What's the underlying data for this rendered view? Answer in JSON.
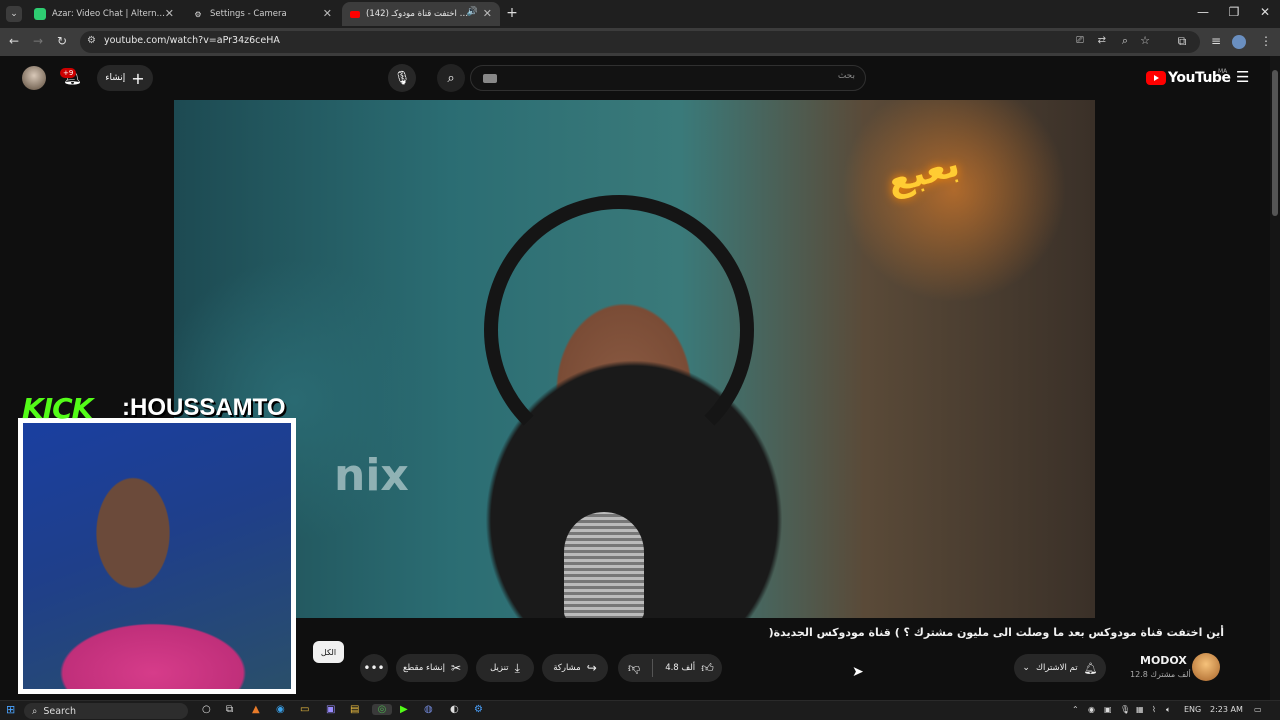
{
  "browser": {
    "tabs": [
      {
        "title": "Azar: Video Chat | Alternative to",
        "icon": "azar-icon",
        "color": "#2ecc71"
      },
      {
        "title": "Settings - Camera",
        "icon": "gear-icon",
        "color": "#9e9e9e"
      },
      {
        "title": "أين اختفت قناة مودوكـ (142)",
        "icon": "youtube-icon",
        "color": "#ff0000",
        "active": true
      }
    ],
    "new_tab_label": "+",
    "url": "youtube.com/watch?v=aPr34z6ceHA",
    "window_controls": [
      "—",
      "❐",
      "✕"
    ]
  },
  "youtube": {
    "logo_text": "YouTube",
    "region": "MA",
    "search_placeholder": "بحث",
    "create_label": "إنشاء",
    "notification_count": "+9"
  },
  "overlay": {
    "platform": "KICK",
    "username": ":HOUSSAMTO"
  },
  "video": {
    "title": "أين اختفت قناة مودوكس بعد ما وصلت الى مليون مشترك ؟ ) قناة مودوكس الجديدة(",
    "channel": "MODOX",
    "subscribers": "12.8 ألف مشترك",
    "subscribed_label": "تم الاشتراك",
    "likes": "4.8 ألف",
    "share_label": "مشاركة",
    "download_label": "تنزيل",
    "clip_label": "إنشاء مقطع",
    "all_chip": "الكل",
    "neon_sign": "بعبع",
    "bg_text": "nix"
  },
  "taskbar": {
    "search_label": "Search",
    "language": "ENG",
    "time": "2:23 AM"
  },
  "colors": {
    "youtube_red": "#ff0000",
    "kick_green": "#53fc18",
    "bg": "#0f0f0f"
  }
}
